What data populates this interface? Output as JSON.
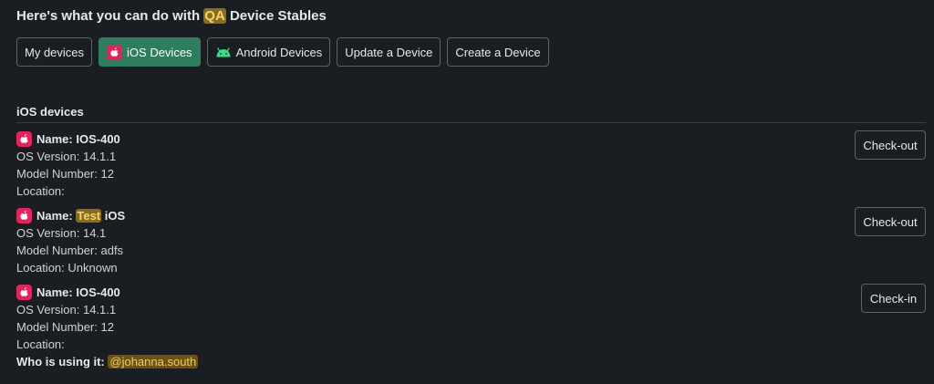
{
  "header": {
    "prefix": "Here's what you can do with ",
    "highlight": "QA",
    "suffix": " Device Stables"
  },
  "tabs": [
    {
      "label": "My devices",
      "icon": null,
      "active": false
    },
    {
      "label": "iOS Devices",
      "icon": "apple-icon",
      "active": true
    },
    {
      "label": "Android Devices",
      "icon": "android-icon",
      "active": false
    },
    {
      "label": "Update a Device",
      "icon": null,
      "active": false
    },
    {
      "label": "Create a Device",
      "icon": null,
      "active": false
    }
  ],
  "section": {
    "title": "iOS devices"
  },
  "devices": [
    {
      "name_label": "Name: ",
      "name_value": "IOS-400",
      "os": "OS Version: 14.1.1",
      "model": "Model Number: 12",
      "location": "Location:",
      "action": "Check-out"
    },
    {
      "name_label": "Name: ",
      "name_highlight": "Test",
      "name_rest": " iOS",
      "os": "OS Version: 14.1",
      "model": "Model Number: adfs",
      "location": "Location: Unknown",
      "action": "Check-out"
    },
    {
      "name_label": "Name: ",
      "name_value": "IOS-400",
      "os": "OS Version: 14.1.1",
      "model": "Model Number: 12",
      "location": "Location:",
      "who_label": "Who is using it: ",
      "who_user": "@johanna.south",
      "action": "Check-in"
    }
  ],
  "colors": {
    "background": "#1a1d21",
    "active_tab": "#2f7d5e",
    "apple_badge": "#e0245e",
    "android_green": "#3ddc84",
    "highlight": "#8a6d1a"
  }
}
